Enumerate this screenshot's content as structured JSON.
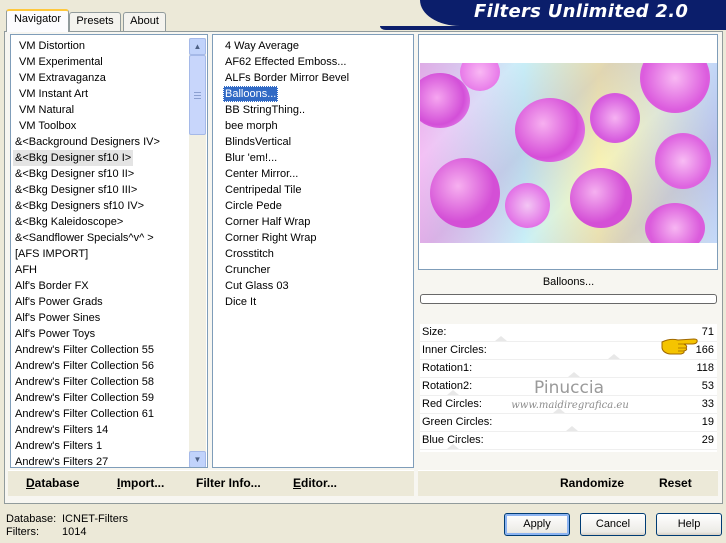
{
  "app": {
    "title": "Filters Unlimited 2.0"
  },
  "tabs": [
    {
      "label": "Navigator",
      "active": true
    },
    {
      "label": "Presets",
      "active": false
    },
    {
      "label": "About",
      "active": false
    }
  ],
  "categories": [
    "VM Distortion",
    "VM Experimental",
    "VM Extravaganza",
    "VM Instant Art",
    "VM Natural",
    "VM Toolbox",
    "&<Background Designers IV>",
    "&<Bkg Designer sf10 I>",
    "&<Bkg Designer sf10 II>",
    "&<Bkg Designer sf10 III>",
    "&<Bkg Designers sf10 IV>",
    "&<Bkg Kaleidoscope>",
    "&<Sandflower Specials^v^ >",
    "[AFS IMPORT]",
    "AFH",
    "Alf's Border FX",
    "Alf's Power Grads",
    "Alf's Power Sines",
    "Alf's Power Toys",
    "Andrew's Filter Collection 55",
    "Andrew's Filter Collection 56",
    "Andrew's Filter Collection 58",
    "Andrew's Filter Collection 59",
    "Andrew's Filter Collection 61",
    "Andrew's Filters 14",
    "Andrew's Filters 1",
    "Andrew's Filters 27"
  ],
  "selected_category": "&<Bkg Designer sf10 I>",
  "filters": [
    "4 Way Average",
    "AF62 Effected Emboss...",
    "ALFs Border Mirror Bevel",
    "Balloons...",
    "BB StringThing..",
    "bee morph",
    "BlindsVertical",
    "Blur 'em!...",
    "Center Mirror...",
    "Centripedal Tile",
    "Circle Pede",
    "Corner Half Wrap",
    "Corner Right Wrap",
    "Crosstitch",
    "Cruncher",
    "Cut Glass 03",
    "Dice It"
  ],
  "selected_filter": "Balloons...",
  "current_filter_name": "Balloons...",
  "params": [
    {
      "label": "Size:",
      "value": "71"
    },
    {
      "label": "Inner Circles:",
      "value": "166"
    },
    {
      "label": "Rotation1:",
      "value": "118"
    },
    {
      "label": "Rotation2:",
      "value": "53"
    },
    {
      "label": "Red Circles:",
      "value": "33"
    },
    {
      "label": "Green Circles:",
      "value": "19"
    },
    {
      "label": "Blue Circles:",
      "value": "29"
    }
  ],
  "watermark": {
    "name": "Pinuccia",
    "url": "www.maidiregrafica.eu"
  },
  "left_buttons": [
    {
      "label": "Database",
      "underline": "D",
      "rest": "atabase"
    },
    {
      "label": "Import...",
      "underline": "I",
      "rest": "mport..."
    },
    {
      "label": "Filter Info...",
      "underline": "",
      "rest": "Filter Info..."
    },
    {
      "label": "Editor...",
      "underline": "E",
      "rest": "ditor..."
    }
  ],
  "right_buttons": {
    "randomize": "Randomize",
    "reset": "Reset"
  },
  "status": {
    "database_label": "Database:",
    "database_value": "ICNET-Filters",
    "filters_label": "Filters:",
    "filters_value": "1014"
  },
  "dialog_buttons": {
    "apply": "Apply",
    "cancel": "Cancel",
    "help": "Help"
  },
  "colors": {
    "banner": "#0B1E6B",
    "selection": "#316AC5",
    "dialog_bg": "#ECE9D8"
  },
  "icons": {
    "pointing_hand": "pointing-hand-icon"
  }
}
